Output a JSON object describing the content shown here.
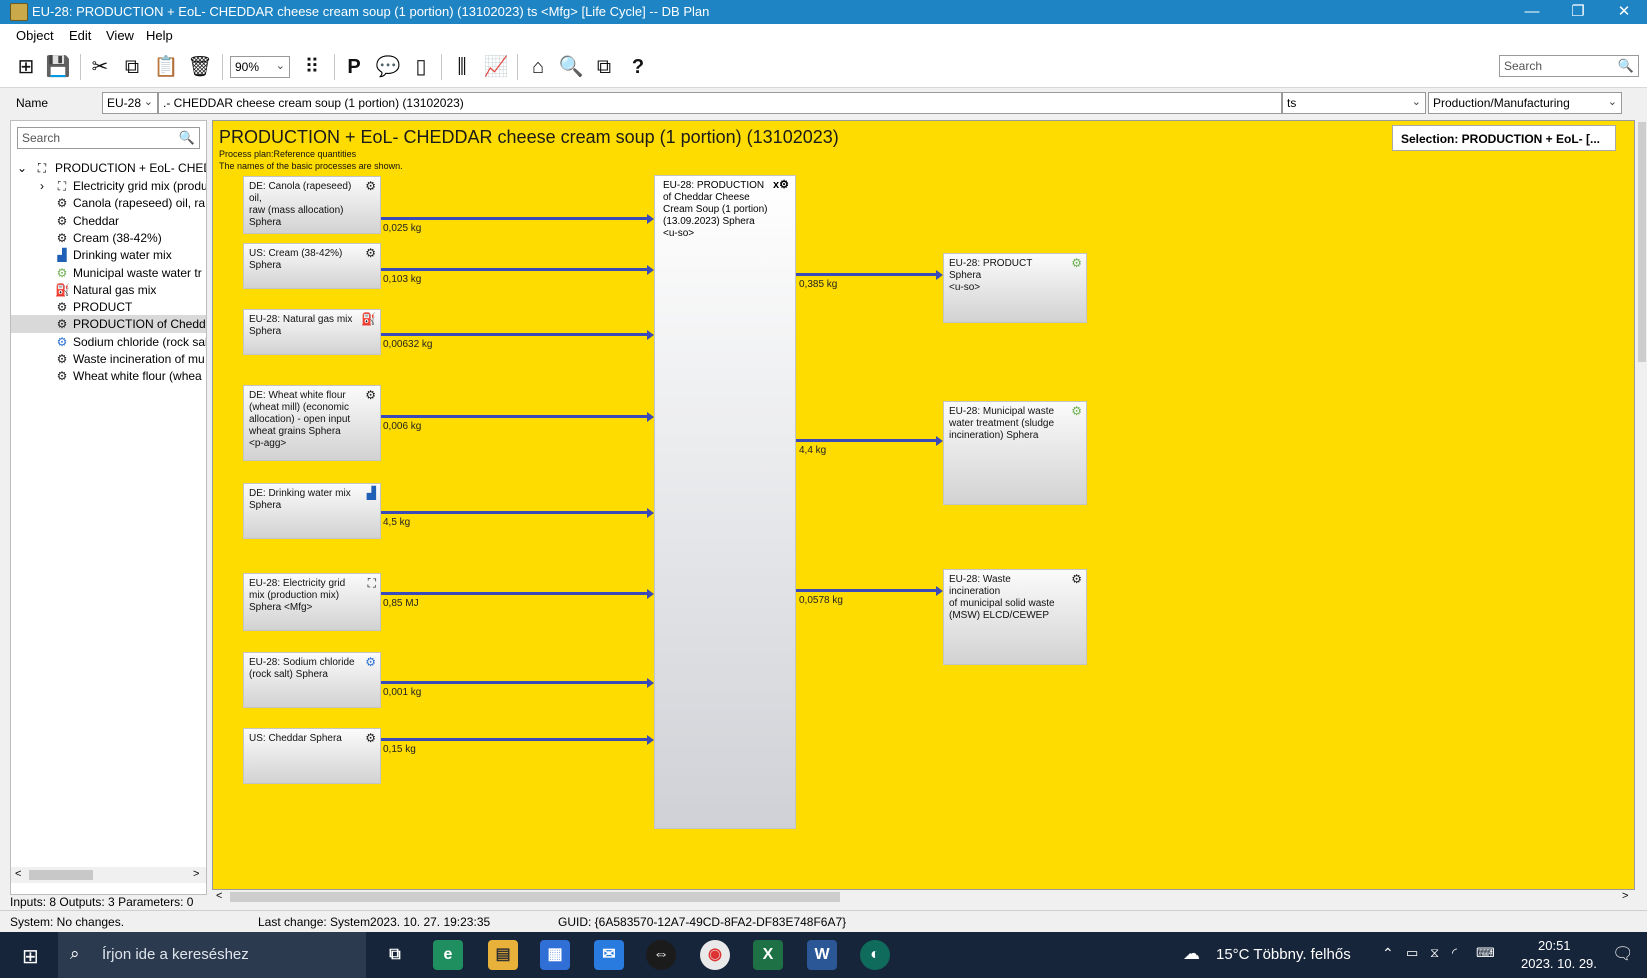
{
  "window": {
    "title": "EU-28: PRODUCTION + EoL- CHEDDAR cheese cream soup (1 portion) (13102023) ts <Mfg> [Life Cycle] -- DB Plan",
    "minimize": "—",
    "restore": "❐",
    "close": "✕"
  },
  "menu": [
    "Object",
    "Edit",
    "View",
    "Help"
  ],
  "toolbar": {
    "zoom": "90%",
    "search_placeholder": "Search"
  },
  "namerow": {
    "label": "Name",
    "region": "EU-28",
    "name_value": ".- CHEDDAR cheese cream soup (1 portion) (13102023)",
    "source": "ts",
    "type": "Production/Manufacturing"
  },
  "tree": {
    "search_placeholder": "Search",
    "root": "PRODUCTION + EoL- CHEDD",
    "items": [
      {
        "label": "Electricity grid mix (produ",
        "icon": "grid-icon"
      },
      {
        "label": "Canola (rapeseed) oil, ra",
        "icon": "process-icon"
      },
      {
        "label": "Cheddar",
        "icon": "process-icon"
      },
      {
        "label": "Cream (38-42%)",
        "icon": "process-icon"
      },
      {
        "label": "Drinking water mix",
        "icon": "water-icon"
      },
      {
        "label": "Municipal waste water tr",
        "icon": "waste-icon"
      },
      {
        "label": "Natural gas mix",
        "icon": "gas-icon"
      },
      {
        "label": "PRODUCT",
        "icon": "process-icon"
      },
      {
        "label": "PRODUCTION of Chedda",
        "icon": "process-icon"
      },
      {
        "label": "Sodium chloride (rock salt",
        "icon": "gear-icon"
      },
      {
        "label": "Waste incineration of mu",
        "icon": "process-icon"
      },
      {
        "label": "Wheat white flour (whea",
        "icon": "process-icon"
      }
    ]
  },
  "plan": {
    "title": "PRODUCTION + EoL- CHEDDAR cheese cream soup (1 portion) (13102023)",
    "subtitle1": "Process plan:Reference quantities",
    "subtitle2": "The names of the basic processes are shown.",
    "selection": "Selection: PRODUCTION + EoL- [...",
    "main_process": {
      "lines": [
        "EU-28: PRODUCTION",
        "of Cheddar Cheese",
        "Cream Soup (1 portion)",
        "(13.09.2023) Sphera",
        "<u-so>"
      ]
    },
    "inputs": [
      {
        "lines": [
          "DE: Canola (rapeseed) oil,",
          "raw (mass allocation)",
          "Sphera"
        ],
        "qty": "0,025 kg",
        "icon": "process-icon"
      },
      {
        "lines": [
          "US: Cream (38-42%)",
          "Sphera"
        ],
        "qty": "0,103 kg",
        "icon": "process-icon"
      },
      {
        "lines": [
          "EU-28: Natural gas mix",
          "Sphera"
        ],
        "qty": "0,00632 kg",
        "icon": "gas-icon"
      },
      {
        "lines": [
          "DE: Wheat white flour",
          "(wheat mill) (economic",
          "allocation) - open input",
          "wheat grains Sphera",
          "<p-agg>"
        ],
        "qty": "0,006 kg",
        "icon": "process-icon"
      },
      {
        "lines": [
          "DE: Drinking water mix",
          "Sphera"
        ],
        "qty": "4,5 kg",
        "icon": "water-icon"
      },
      {
        "lines": [
          "EU-28: Electricity grid",
          "mix (production mix)",
          "Sphera <Mfg>"
        ],
        "qty": "0,85 MJ",
        "icon": "grid-icon"
      },
      {
        "lines": [
          "EU-28: Sodium chloride",
          "(rock salt) Sphera"
        ],
        "qty": "0,001 kg",
        "icon": "gear-icon"
      },
      {
        "lines": [
          "US: Cheddar Sphera"
        ],
        "qty": "0,15 kg",
        "icon": "process-icon"
      }
    ],
    "outputs": [
      {
        "lines": [
          "EU-28: PRODUCT Sphera",
          "<u-so>"
        ],
        "qty": "0,385 kg",
        "icon": "waste-icon"
      },
      {
        "lines": [
          "EU-28: Municipal waste",
          "water treatment (sludge",
          "incineration) Sphera"
        ],
        "qty": "4,4 kg",
        "icon": "waste-icon"
      },
      {
        "lines": [
          "EU-28: Waste incineration",
          "of municipal solid waste",
          "(MSW) ELCD/CEWEP"
        ],
        "qty": "0,0578 kg",
        "icon": "process-icon"
      }
    ]
  },
  "status": {
    "io": "Inputs: 8 Outputs: 3 Parameters: 0",
    "system": "System: No changes.",
    "last_change": "Last change: System2023. 10. 27. 19:23:35",
    "guid": "GUID: {6A583570-12A7-49CD-8FA2-DF83E748F6A7}"
  },
  "taskbar": {
    "search_placeholder": "Írjon ide a kereséshez",
    "weather": "15°C  Többny. felhős",
    "time": "20:51",
    "date": "2023. 10. 29."
  }
}
